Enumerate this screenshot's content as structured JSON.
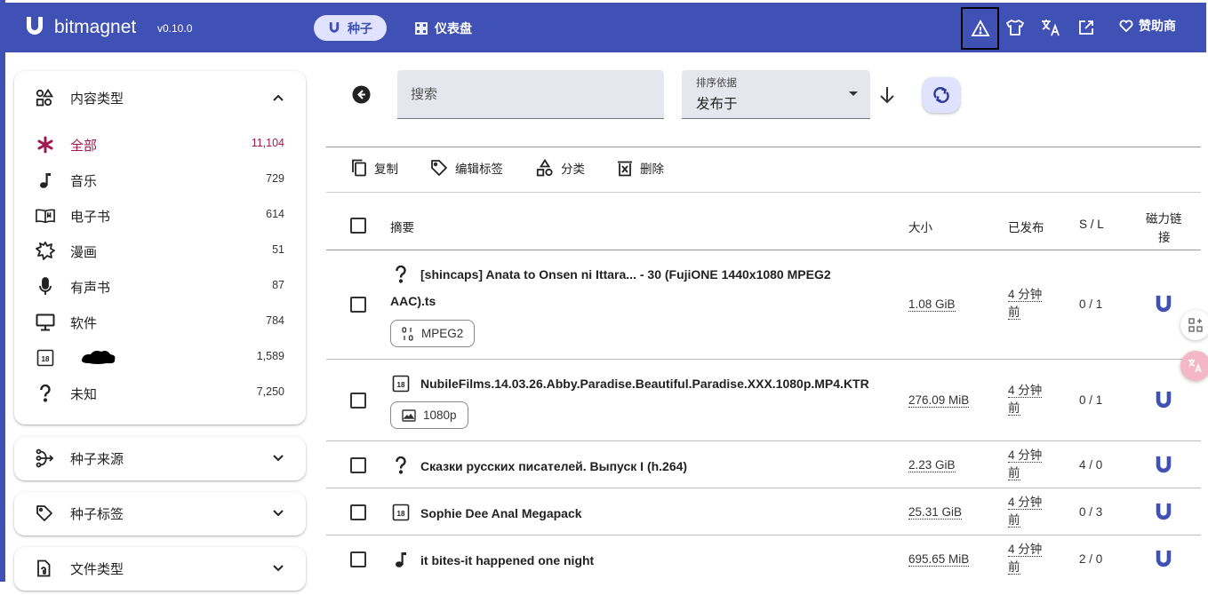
{
  "header": {
    "brand": "bitmagnet",
    "version": "v0.10.0",
    "tab_torrents": "种子",
    "tab_dashboard": "仪表盘",
    "sponsor": "赞助商"
  },
  "sidebar": {
    "content_type": {
      "title": "内容类型",
      "items": [
        {
          "label": "全部",
          "count": "11,104",
          "icon": "asterisk-icon"
        },
        {
          "label": "音乐",
          "count": "729",
          "icon": "music-note-icon"
        },
        {
          "label": "电子书",
          "count": "614",
          "icon": "book-icon"
        },
        {
          "label": "漫画",
          "count": "51",
          "icon": "comic-bubble-icon"
        },
        {
          "label": "有声书",
          "count": "87",
          "icon": "microphone-icon"
        },
        {
          "label": "软件",
          "count": "784",
          "icon": "desktop-icon"
        },
        {
          "label": "",
          "count": "1,589",
          "icon": "adult-18-icon"
        },
        {
          "label": "未知",
          "count": "7,250",
          "icon": "question-icon"
        }
      ]
    },
    "torrent_source": "种子来源",
    "torrent_tags": "种子标签",
    "file_type": "文件类型"
  },
  "search": {
    "placeholder": "搜索"
  },
  "sort": {
    "label": "排序依据",
    "value": "发布于"
  },
  "toolbar": {
    "copy": "复制",
    "edit_tags": "编辑标签",
    "classify": "分类",
    "delete": "删除"
  },
  "table": {
    "headers": {
      "summary": "摘要",
      "size": "大小",
      "published": "已发布",
      "sl": "S / L",
      "magnet_line1": "磁力链",
      "magnet_line2": "接"
    },
    "rows": [
      {
        "icon": "question-icon",
        "title_line1": "[shincaps] Anata to Onsen ni Ittara... - 30 (FujiONE 1440x1080 MPEG2",
        "title_line2": "AAC).ts",
        "chip": "MPEG2",
        "chip_icon": "binary-icon",
        "size": "1.08 GiB",
        "pub1": "4 分钟",
        "pub2": "前",
        "sl": "0 / 1"
      },
      {
        "icon": "adult-18-icon",
        "title_line1": "NubileFilms.14.03.26.Abby.Paradise.Beautiful.Paradise.XXX.1080p.MP4.KTR",
        "chip": "1080p",
        "chip_icon": "image-icon",
        "size": "276.09 MiB",
        "pub1": "4 分钟",
        "pub2": "前",
        "sl": "0 / 1"
      },
      {
        "icon": "question-icon",
        "title_line1": "Сказки русских писателей. Выпуск I (h.264)",
        "size": "2.23 GiB",
        "pub1": "4 分钟",
        "pub2": "前",
        "sl": "4 / 0"
      },
      {
        "icon": "adult-18-icon",
        "title_line1": "Sophie Dee Anal Megapack",
        "size": "25.31 GiB",
        "pub1": "4 分钟",
        "pub2": "前",
        "sl": "0 / 3"
      },
      {
        "icon": "music-note-icon",
        "title_line1": "it bites-it happened one night",
        "size": "695.65 MiB",
        "pub1": "4 分钟",
        "pub2": "前",
        "sl": "2 / 0"
      }
    ]
  },
  "colors": {
    "primary": "#3f51b5",
    "accent": "#a0184f",
    "tonal": "#dfe3ff"
  }
}
